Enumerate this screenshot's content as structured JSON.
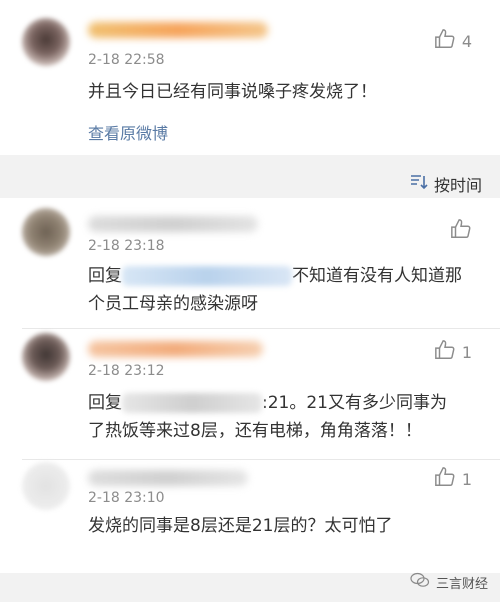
{
  "top_comment": {
    "time": "2-18 22:58",
    "likes": "4",
    "text": "并且今日已经有同事说嗓子疼发烧了！",
    "link": "查看原微博"
  },
  "sort": {
    "label": "按时间"
  },
  "comments": [
    {
      "time": "2-18 23:18",
      "likes": "",
      "reply_prefix": "回复",
      "text_line1": "不知道有没有人知道那",
      "text_line2": "个员工母亲的感染源呀"
    },
    {
      "time": "2-18 23:12",
      "likes": "1",
      "reply_prefix": "回复",
      "text_line1": ":21。21又有多少同事为",
      "text_line2": "了热饭等来过8层，还有电梯，角角落落！！"
    },
    {
      "time": "2-18 23:10",
      "likes": "1",
      "text": "发烧的同事是8层还是21层的？太可怕了"
    }
  ],
  "watermark": {
    "text": "三言财经"
  }
}
